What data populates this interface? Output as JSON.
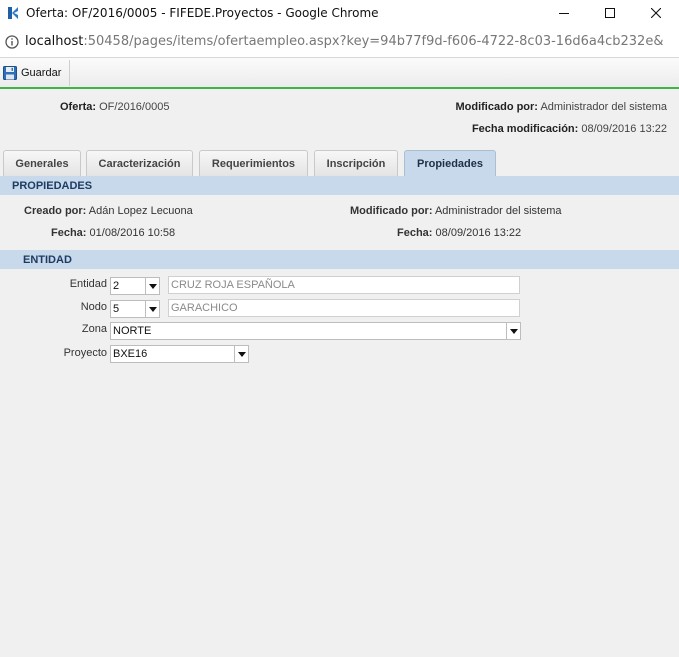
{
  "window": {
    "title": "Oferta: OF/2016/0005 - FIFEDE.Proyectos - Google Chrome",
    "url_host": "localhost",
    "url_rest": ":50458/pages/items/ofertaempleo.aspx?key=94b77f9d-f606-4722-8c03-16d6a4cb232e&",
    "icons": {
      "app": "fifede-logo-icon",
      "info": "info-icon",
      "minimize": "minimize-icon",
      "maximize": "maximize-icon",
      "close": "close-icon"
    }
  },
  "toolbar": {
    "save_label": "Guardar",
    "save_icon": "floppy-disk-icon"
  },
  "header": {
    "oferta_label": "Oferta:",
    "oferta_value": "OF/2016/0005",
    "modificado_label": "Modificado por:",
    "modificado_value": "Administrador del sistema",
    "fecha_mod_label": "Fecha modificación:",
    "fecha_mod_value": "08/09/2016 13:22"
  },
  "tabs": [
    {
      "label": "Generales",
      "active": false
    },
    {
      "label": "Caracterización",
      "active": false
    },
    {
      "label": "Requerimientos",
      "active": false
    },
    {
      "label": "Inscripción",
      "active": false
    },
    {
      "label": "Propiedades",
      "active": true
    }
  ],
  "propiedades": {
    "title": "PROPIEDADES",
    "creado_label": "Creado por:",
    "creado_value": "Adán Lopez Lecuona",
    "modificado_label": "Modificado por:",
    "modificado_value": "Administrador del sistema",
    "fecha1_label": "Fecha:",
    "fecha1_value": "01/08/2016 10:58",
    "fecha2_label": "Fecha:",
    "fecha2_value": "08/09/2016 13:22"
  },
  "entidad": {
    "title": "ENTIDAD",
    "entidad_label": "Entidad",
    "entidad_code": "2",
    "entidad_name": "CRUZ ROJA ESPAÑOLA",
    "nodo_label": "Nodo",
    "nodo_code": "5",
    "nodo_name": "GARACHICO",
    "zona_label": "Zona",
    "zona_value": "NORTE",
    "proyecto_label": "Proyecto",
    "proyecto_value": "BXE16"
  },
  "colors": {
    "accent_green": "#3fb24a",
    "section_blue": "#c7d9ea",
    "section_text": "#1e3c63"
  }
}
